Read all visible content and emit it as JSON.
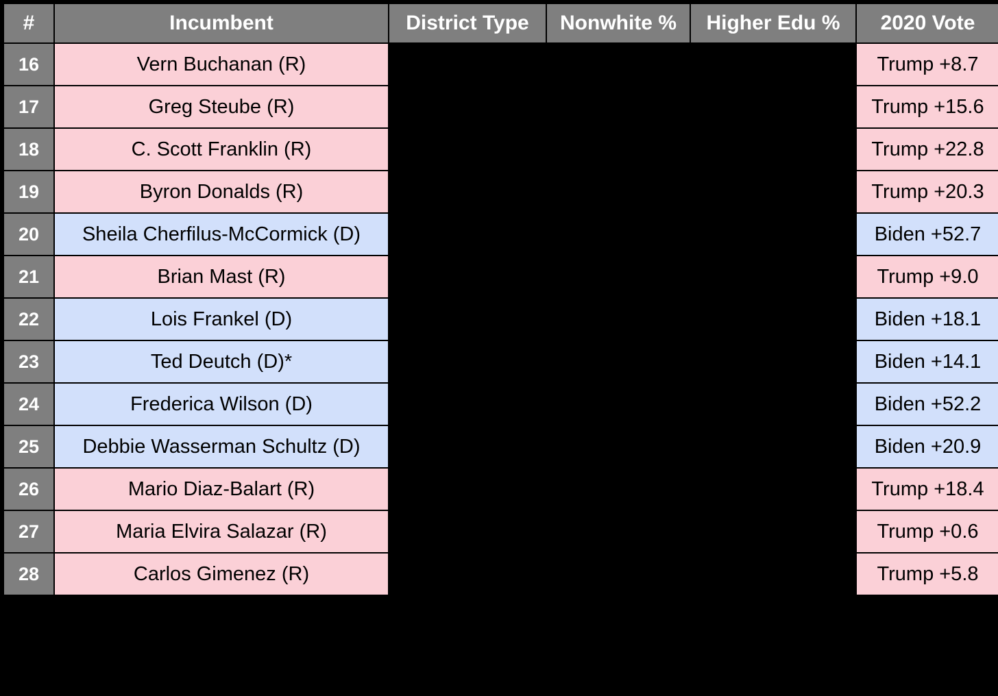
{
  "table": {
    "columns": [
      {
        "key": "number",
        "label": "#",
        "name": "col-number"
      },
      {
        "key": "incumbent",
        "label": "Incumbent",
        "name": "col-incumbent"
      },
      {
        "key": "dtype",
        "label": "District Type",
        "name": "col-district-type"
      },
      {
        "key": "nonwhite",
        "label": "Nonwhite %",
        "name": "col-nonwhite-pct"
      },
      {
        "key": "edu",
        "label": "Higher Edu %",
        "name": "col-higher-edu-pct"
      },
      {
        "key": "vote",
        "label": "2020 Vote",
        "name": "col-2020-vote"
      }
    ],
    "colors": {
      "header_bg": "#7f7f7f",
      "header_text": "#ffffff",
      "republican_bg": "#fbd0d7",
      "democrat_bg": "#d2e0fb",
      "masked_bg": "#000000",
      "page_bg": "#000000"
    },
    "rows": [
      {
        "number": "16",
        "incumbent": "Vern Buchanan (R)",
        "party": "R",
        "dtype": "",
        "nonwhite": "",
        "edu": "",
        "vote": "Trump +8.7"
      },
      {
        "number": "17",
        "incumbent": "Greg Steube (R)",
        "party": "R",
        "dtype": "",
        "nonwhite": "",
        "edu": "",
        "vote": "Trump +15.6"
      },
      {
        "number": "18",
        "incumbent": "C. Scott Franklin (R)",
        "party": "R",
        "dtype": "",
        "nonwhite": "",
        "edu": "",
        "vote": "Trump +22.8"
      },
      {
        "number": "19",
        "incumbent": "Byron Donalds (R)",
        "party": "R",
        "dtype": "",
        "nonwhite": "",
        "edu": "",
        "vote": "Trump +20.3"
      },
      {
        "number": "20",
        "incumbent": "Sheila Cherfilus-McCormick (D)",
        "party": "D",
        "dtype": "",
        "nonwhite": "",
        "edu": "",
        "vote": "Biden +52.7"
      },
      {
        "number": "21",
        "incumbent": "Brian Mast (R)",
        "party": "R",
        "dtype": "",
        "nonwhite": "",
        "edu": "",
        "vote": "Trump +9.0"
      },
      {
        "number": "22",
        "incumbent": "Lois Frankel (D)",
        "party": "D",
        "dtype": "",
        "nonwhite": "",
        "edu": "",
        "vote": "Biden +18.1"
      },
      {
        "number": "23",
        "incumbent": "Ted Deutch (D)*",
        "party": "D",
        "dtype": "",
        "nonwhite": "",
        "edu": "",
        "vote": "Biden +14.1"
      },
      {
        "number": "24",
        "incumbent": "Frederica Wilson (D)",
        "party": "D",
        "dtype": "",
        "nonwhite": "",
        "edu": "",
        "vote": "Biden +52.2"
      },
      {
        "number": "25",
        "incumbent": "Debbie Wasserman Schultz (D)",
        "party": "D",
        "dtype": "",
        "nonwhite": "",
        "edu": "",
        "vote": "Biden +20.9"
      },
      {
        "number": "26",
        "incumbent": "Mario Diaz-Balart (R)",
        "party": "R",
        "dtype": "",
        "nonwhite": "",
        "edu": "",
        "vote": "Trump +18.4"
      },
      {
        "number": "27",
        "incumbent": "Maria Elvira Salazar (R)",
        "party": "R",
        "dtype": "",
        "nonwhite": "",
        "edu": "",
        "vote": "Trump +0.6"
      },
      {
        "number": "28",
        "incumbent": "Carlos Gimenez (R)",
        "party": "R",
        "dtype": "",
        "nonwhite": "",
        "edu": "",
        "vote": "Trump +5.8"
      }
    ]
  }
}
